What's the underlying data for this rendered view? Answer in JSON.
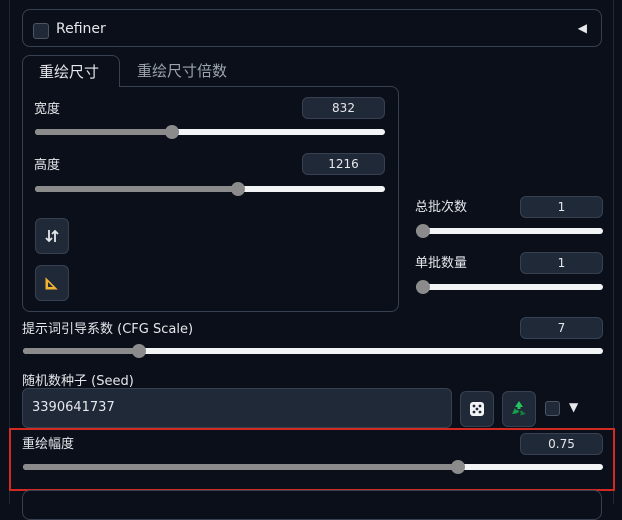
{
  "refiner": {
    "label": "Refiner",
    "checked": false,
    "collapse_icon": "triangle-left-icon"
  },
  "tabs": [
    {
      "label": "重绘尺寸",
      "active": true
    },
    {
      "label": "重绘尺寸倍数",
      "active": false
    }
  ],
  "width": {
    "label": "宽度",
    "value": "832",
    "fraction": 0.39
  },
  "height": {
    "label": "高度",
    "value": "1216",
    "fraction": 0.58
  },
  "buttons": {
    "swap_icon": "swap-vertical-icon",
    "aspect_icon": "triangle-ruler-icon"
  },
  "batch_count": {
    "label": "总批次数",
    "value": "1",
    "fraction": 0.0
  },
  "batch_size": {
    "label": "单批数量",
    "value": "1",
    "fraction": 0.0
  },
  "cfg": {
    "label": "提示词引导系数 (CFG Scale)",
    "value": "7",
    "fraction": 0.2
  },
  "seed": {
    "label": "随机数种子 (Seed)",
    "value": "3390641737",
    "dice_icon": "dice-icon",
    "recycle_icon": "recycle-icon",
    "extra_checked": false
  },
  "denoise": {
    "label": "重绘幅度",
    "value": "0.75",
    "fraction": 0.75
  }
}
